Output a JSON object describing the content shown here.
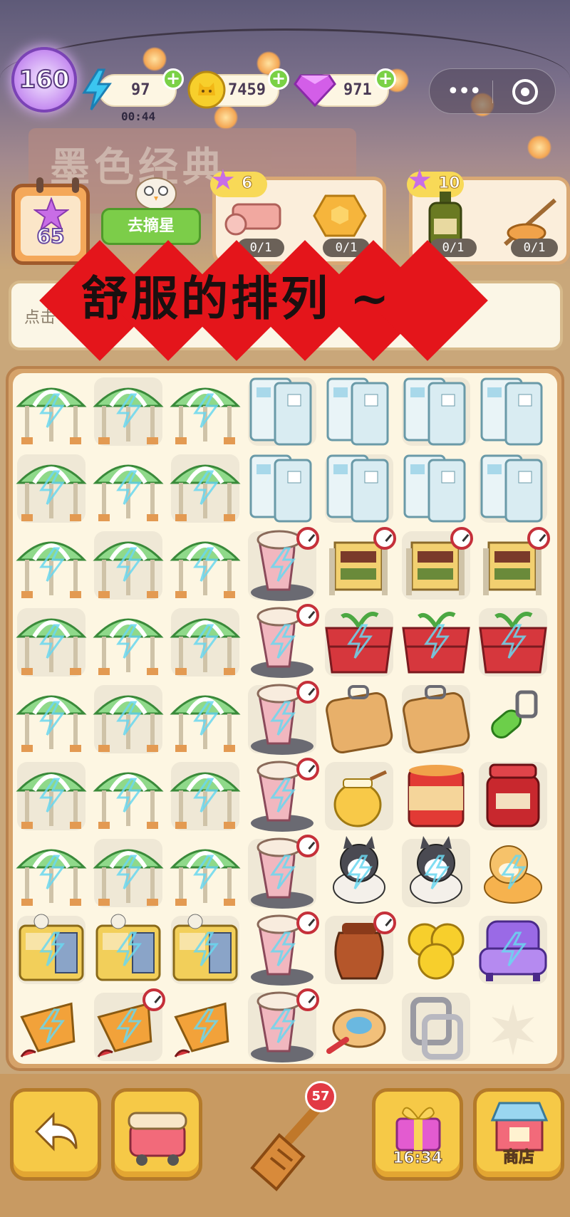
{
  "hud": {
    "level": "160",
    "energy": "97",
    "energy_timer": "00:44",
    "coins": "7459",
    "gems": "971",
    "plus_label": "+",
    "capsule_menu": "•••"
  },
  "background": {
    "sign_text": "墨色经典"
  },
  "calendar": {
    "stars": "65"
  },
  "goto_button": "去摘星",
  "orders": [
    {
      "stars": "6",
      "items": [
        {
          "icon": "fabric-roll-icon",
          "progress": "0/1"
        },
        {
          "icon": "honeycomb-icon",
          "progress": "0/1"
        }
      ]
    },
    {
      "stars": "10",
      "items": [
        {
          "icon": "oil-bottle-icon",
          "progress": "0/1"
        },
        {
          "icon": "fish-on-rod-icon",
          "progress": "0/1"
        }
      ]
    }
  ],
  "hint": {
    "text": "点击"
  },
  "banner": {
    "text": "舒服的排列 ~"
  },
  "board": {
    "rows": [
      [
        "umbrella",
        "umbrella",
        "umbrella",
        "fridge",
        "fridge",
        "fridge",
        "fridge"
      ],
      [
        "umbrella",
        "umbrella",
        "umbrella",
        "fridge",
        "fridge",
        "fridge",
        "fridge"
      ],
      [
        "umbrella",
        "umbrella",
        "umbrella",
        "toilet",
        "shelf",
        "shelf",
        "shelf"
      ],
      [
        "umbrella",
        "umbrella",
        "umbrella",
        "toilet",
        "planter",
        "planter",
        "planter"
      ],
      [
        "umbrella",
        "umbrella",
        "umbrella",
        "toilet",
        "cutting-board",
        "cutting-board",
        "peeler"
      ],
      [
        "umbrella",
        "umbrella",
        "umbrella",
        "toilet",
        "honey-pot",
        "tin-can",
        "jam-jar"
      ],
      [
        "umbrella",
        "umbrella",
        "umbrella",
        "toilet",
        "husky",
        "husky",
        "shiba"
      ],
      [
        "cabinet",
        "cabinet",
        "cabinet",
        "toilet",
        "clay-jar",
        "gold-coins",
        "armchair"
      ],
      [
        "hot-pot",
        "hot-pot",
        "hot-pot",
        "toilet",
        "spinning-top",
        "chair-frame",
        "empty"
      ]
    ]
  },
  "bottom": {
    "spatula_energy": "57",
    "gift_timer": "16:34",
    "shop_label": "商店"
  },
  "colors": {
    "accent_red": "#e4151b",
    "board_bg": "#fdf6e2",
    "button_yellow": "#f6c947",
    "plus_green": "#7ad146"
  }
}
